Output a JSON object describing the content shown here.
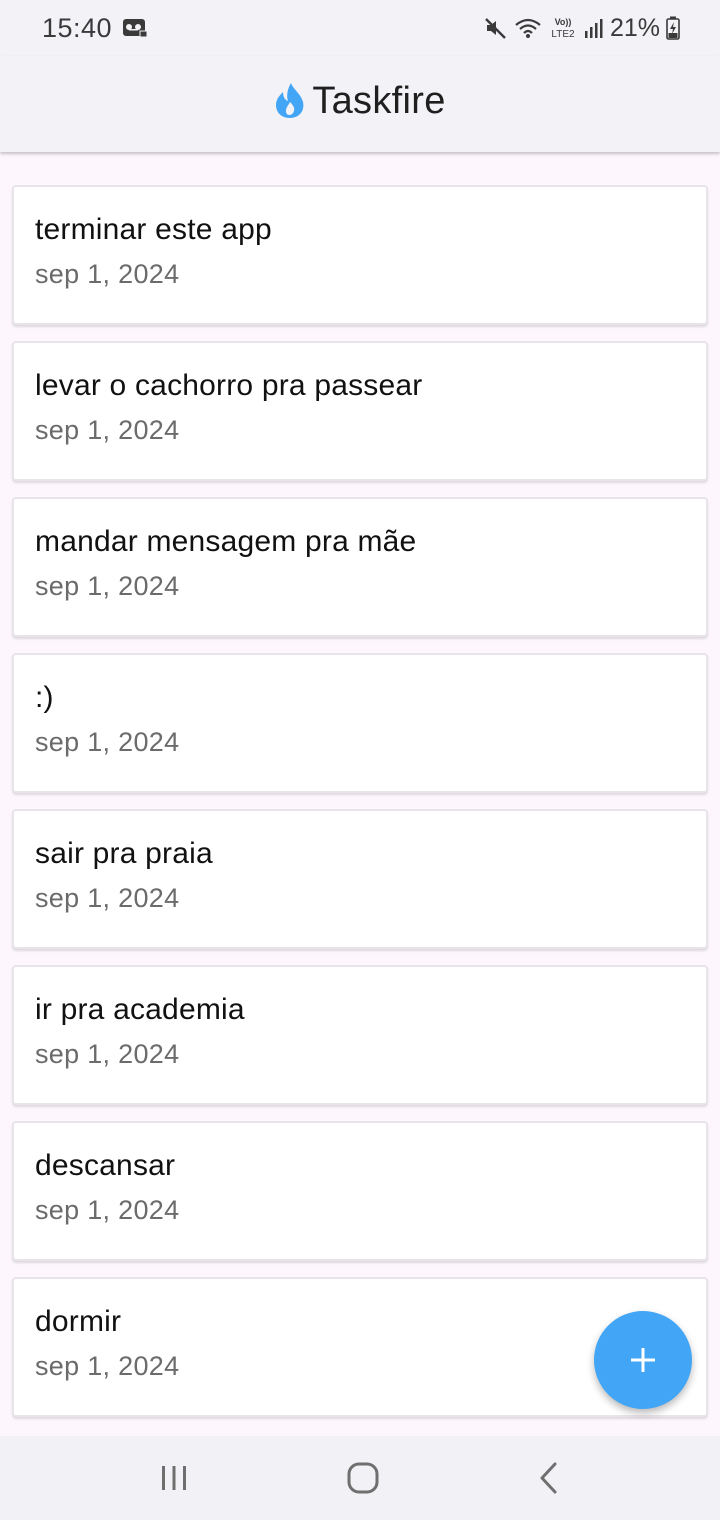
{
  "status_bar": {
    "time": "15:40",
    "battery": "21%",
    "icons": [
      "voicemail-icon",
      "mute-icon",
      "wifi-icon",
      "volte-icon",
      "signal-icon",
      "battery-icon"
    ]
  },
  "app_bar": {
    "title": "Taskfire",
    "logo_icon": "flame-icon"
  },
  "tasks": [
    {
      "title": "terminar este app",
      "date": "sep 1, 2024"
    },
    {
      "title": "levar o cachorro pra passear",
      "date": "sep 1, 2024"
    },
    {
      "title": "mandar mensagem pra mãe",
      "date": "sep 1, 2024"
    },
    {
      "title": ":)",
      "date": "sep 1, 2024"
    },
    {
      "title": "sair pra praia",
      "date": "sep 1, 2024"
    },
    {
      "title": "ir pra academia",
      "date": "sep 1, 2024"
    },
    {
      "title": "descansar",
      "date": "sep 1, 2024"
    },
    {
      "title": "dormir",
      "date": "sep 1, 2024"
    }
  ],
  "fab": {
    "icon": "plus-icon"
  },
  "nav_bar": {
    "buttons": [
      "recents-icon",
      "home-icon",
      "back-icon"
    ]
  },
  "colors": {
    "accent": "#42A5F5",
    "background": "#FDF7FD",
    "app_bar": "#F3F2F6"
  }
}
